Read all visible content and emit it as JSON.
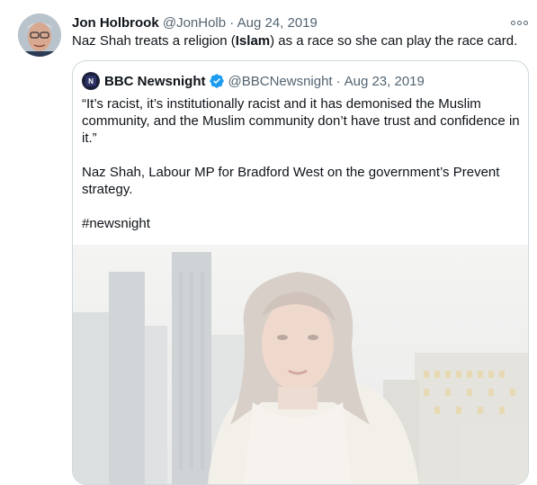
{
  "tweet": {
    "author_name": "Jon Holbrook",
    "handle": "@JonHolb",
    "separator": "·",
    "date": "Aug 24, 2019",
    "text_before": "Naz Shah treats a religion (",
    "text_bold": "Islam",
    "text_after": ") as a race so she can play the race card."
  },
  "quoted": {
    "author_name": "BBC Newsnight",
    "handle": "@BBCNewsnight",
    "separator": "·",
    "date": "Aug 23, 2019",
    "paragraph_1": "“It’s racist, it’s institutionally racist and it has demonised the Muslim community, and the Muslim community don’t have trust and confidence in it.”",
    "paragraph_2": "Naz Shah, Labour MP for Bradford West on the government’s Prevent strategy.",
    "hashtag": "#newsnight"
  },
  "icons": {
    "more": "more-horizontal-icon",
    "verified": "verified-badge-icon",
    "avatar": "user-avatar",
    "bbc_avatar": "bbc-newsnight-logo"
  },
  "colors": {
    "verified_blue": "#1d9bf0",
    "muted_text": "#536471",
    "border": "#cfd9de"
  }
}
